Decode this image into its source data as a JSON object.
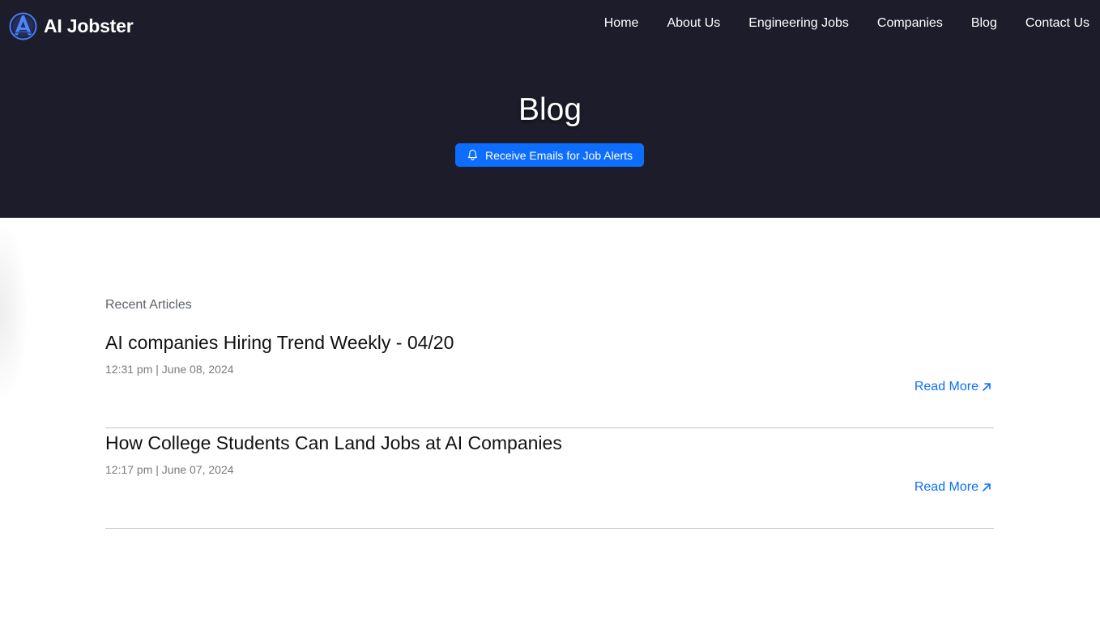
{
  "brand": {
    "name": "AI Jobster",
    "logo_icon": "a-letter-logo-icon"
  },
  "nav": {
    "items": [
      {
        "label": "Home"
      },
      {
        "label": "About Us"
      },
      {
        "label": "Engineering Jobs"
      },
      {
        "label": "Companies"
      },
      {
        "label": "Blog"
      },
      {
        "label": "Contact Us"
      }
    ]
  },
  "hero": {
    "title": "Blog",
    "alert_button": {
      "label": "Receive Emails for Job Alerts",
      "icon": "bell-icon"
    }
  },
  "articles": {
    "section_label": "Recent Articles",
    "items": [
      {
        "title": "AI companies Hiring Trend Weekly - 04/20",
        "meta": "12:31 pm | June 08, 2024",
        "read_more": "Read More",
        "read_more_icon": "arrow-up-right-icon"
      },
      {
        "title": "How College Students Can Land Jobs at AI Companies",
        "meta": "12:17 pm | June 07, 2024",
        "read_more": "Read More",
        "read_more_icon": "arrow-up-right-icon"
      }
    ]
  },
  "colors": {
    "hero_background": "#1c1c2b",
    "accent": "#0d6efd",
    "text_muted": "#7a7a7a",
    "divider": "#c4c4c4"
  }
}
